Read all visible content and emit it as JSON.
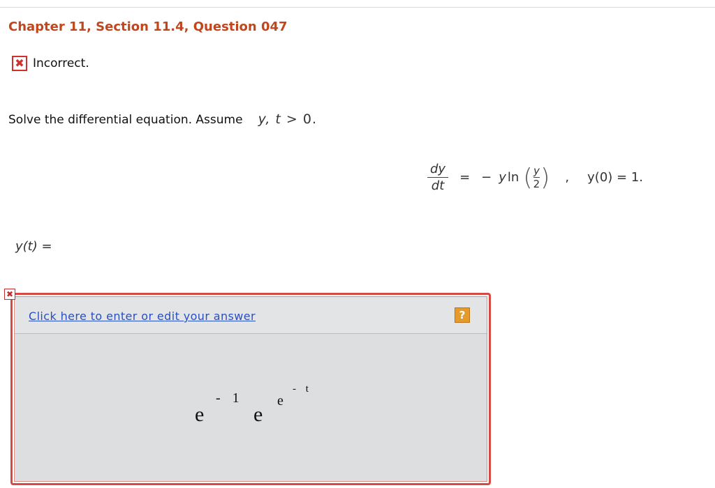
{
  "header": {
    "title": "Chapter 11, Section 11.4, Question 047"
  },
  "status": {
    "icon": "x-mark-icon",
    "glyph": "✖",
    "label": "Incorrect."
  },
  "question": {
    "prompt": "Solve the differential equation. Assume",
    "assumption": {
      "vars": "y, t",
      "rest": " > 0",
      "end": "."
    },
    "equation": {
      "dy": "dy",
      "dt": "dt",
      "equals": "=",
      "minus": "−",
      "y": "y",
      "ln": "ln",
      "frac_num": "y",
      "frac_den": "2",
      "comma": ",",
      "initial_condition": "y(0) = 1."
    },
    "answer_label": {
      "fn": "y(t)",
      "equals": " ="
    }
  },
  "answer_box": {
    "flag_glyph": "✖",
    "edit_link": "Click here to enter or edit your answer",
    "help_glyph": "?",
    "expression": {
      "base1": "e",
      "exp1": "- 1",
      "base2": "e",
      "inner_base": "e",
      "inner_exp": "- t"
    }
  },
  "colors": {
    "heading": "#c0461e",
    "error": "#d0312d",
    "link": "#2a4fbf",
    "help": "#e59a2a",
    "answer_bg": "#dcdee0"
  }
}
